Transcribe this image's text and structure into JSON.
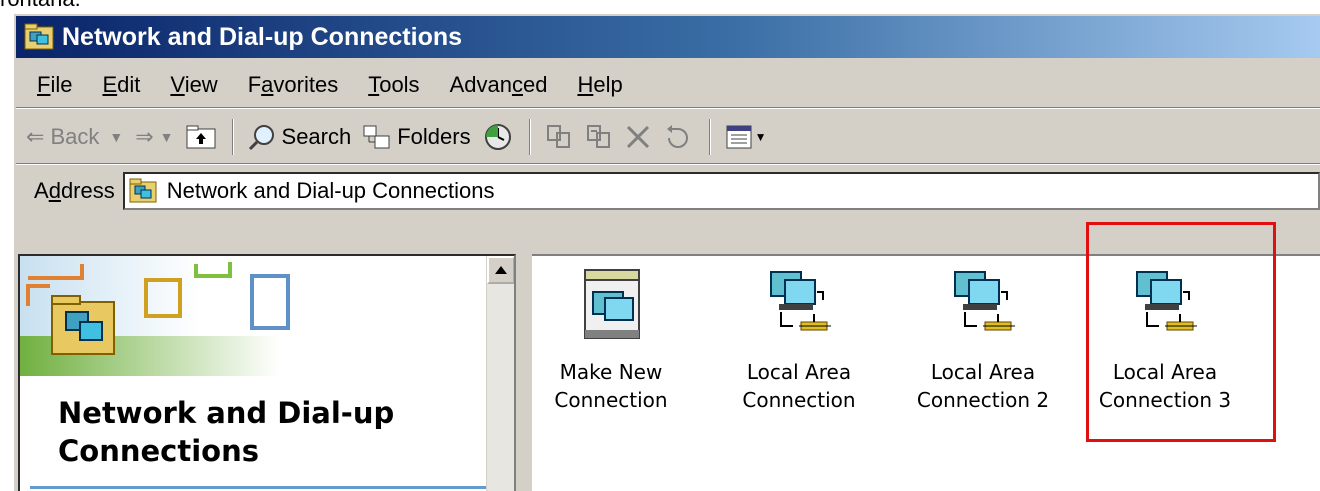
{
  "top_fragment": "rontana:",
  "window": {
    "title": "Network and Dial-up Connections"
  },
  "menu": {
    "items": [
      {
        "label": "File",
        "key": "F",
        "rest": "ile"
      },
      {
        "label": "Edit",
        "key": "E",
        "rest": "dit"
      },
      {
        "label": "View",
        "key": "V",
        "rest": "iew"
      },
      {
        "label": "Favorites",
        "pre": "F",
        "key": "a",
        "rest": "vorites"
      },
      {
        "label": "Tools",
        "key": "T",
        "rest": "ools"
      },
      {
        "label": "Advanced",
        "pre": "Advan",
        "key": "c",
        "rest": "ed"
      },
      {
        "label": "Help",
        "key": "H",
        "rest": "elp"
      }
    ]
  },
  "toolbar": {
    "back_label": "Back",
    "search_label": "Search",
    "folders_label": "Folders"
  },
  "address": {
    "label_pre": "A",
    "label_key": "d",
    "label_rest": "dress",
    "value": "Network and Dial-up Connections"
  },
  "left_pane": {
    "title": "Network and Dial-up Connections"
  },
  "items": [
    {
      "line1": "Make New",
      "line2": "Connection",
      "icon": "make-new-connection-icon"
    },
    {
      "line1": "Local Area",
      "line2": "Connection",
      "icon": "lan-connection-icon"
    },
    {
      "line1": "Local Area",
      "line2": "Connection 2",
      "icon": "lan-connection-icon"
    },
    {
      "line1": "Local Area",
      "line2": "Connection 3",
      "icon": "lan-connection-icon"
    }
  ],
  "colors": {
    "title_gradient_start": "#0a246a",
    "title_gradient_end": "#a6caf0",
    "highlight": "#e01010"
  }
}
